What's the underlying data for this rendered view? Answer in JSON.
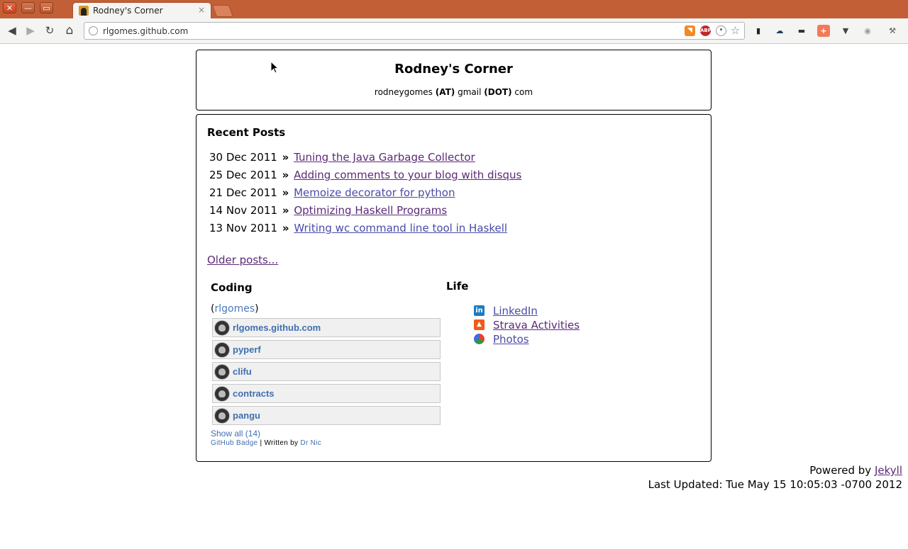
{
  "browser": {
    "tab_title": "Rodney's Corner",
    "url": "rlgomes.github.com",
    "window_buttons": {
      "close": "✕",
      "minimize": "—",
      "maximize": "▭"
    },
    "tab_close": "×",
    "nav": {
      "back": "◀",
      "forward": "▶",
      "reload": "↻",
      "home": "⌂"
    },
    "omnibox_icons": [
      "rss-icon",
      "adblock-icon",
      "reddit-icon",
      "star-icon"
    ],
    "adblock_text": "ABP",
    "extensions": [
      "phone-icon",
      "cloud-icon",
      "glasses-icon",
      "plus-icon",
      "pocket-icon",
      "globe-icon",
      "wrench-icon"
    ]
  },
  "header": {
    "title": "Rodney's Corner",
    "contact_user": "rodneygomes",
    "contact_at": "(AT)",
    "contact_domain": "gmail",
    "contact_dot": "(DOT)",
    "contact_tld": "com"
  },
  "recent": {
    "heading": "Recent Posts",
    "posts": [
      {
        "date": "30 Dec 2011",
        "title": "Tuning the Java Garbage Collector"
      },
      {
        "date": "25 Dec 2011",
        "title": "Adding comments to your blog with disqus"
      },
      {
        "date": "21 Dec 2011",
        "title": "Memoize decorator for python"
      },
      {
        "date": "14 Nov 2011",
        "title": "Optimizing Haskell Programs"
      },
      {
        "date": "13 Nov 2011",
        "title": "Writing wc command line tool in Haskell"
      }
    ],
    "separator": "»",
    "older": "Older posts..."
  },
  "coding": {
    "heading": "Coding",
    "user_open": "(",
    "user": "rlgomes",
    "user_close": ")",
    "repos": [
      "rlgomes.github.com",
      "pyperf",
      "clifu",
      "contracts",
      "pangu"
    ],
    "show_all": "Show all (14)",
    "badge_link": "GitHub Badge",
    "badge_sep": "| Written by",
    "badge_author": "Dr Nic"
  },
  "life": {
    "heading": "Life",
    "links": [
      {
        "label": "LinkedIn",
        "icon": "linkedin-icon",
        "icon_text": "in",
        "color": "#1f7bc1"
      },
      {
        "label": "Strava Activities",
        "icon": "strava-icon",
        "icon_text": "▲",
        "color": "#f05a1a"
      },
      {
        "label": "Photos",
        "icon": "picasa-icon",
        "icon_text": "",
        "color": "#ffffff"
      }
    ]
  },
  "footer": {
    "powered_by": "Powered by",
    "engine": "Jekyll",
    "last_updated": "Last Updated: Tue May 15 10:05:03 -0700 2012"
  },
  "colors": {
    "titlebar": "#c25f36",
    "link": "#4a4aa8",
    "visited": "#5b2a78",
    "badge_link": "#3f6fb0"
  }
}
